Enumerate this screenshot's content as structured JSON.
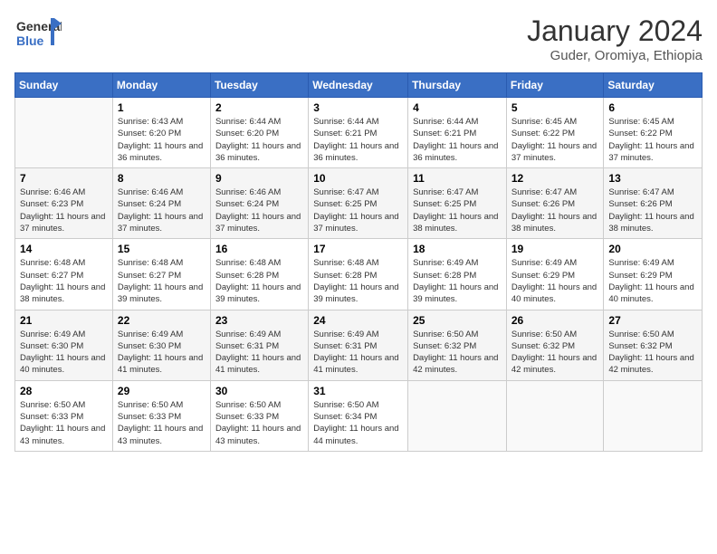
{
  "logo": {
    "general": "General",
    "blue": "Blue"
  },
  "title": "January 2024",
  "subtitle": "Guder, Oromiya, Ethiopia",
  "days_of_week": [
    "Sunday",
    "Monday",
    "Tuesday",
    "Wednesday",
    "Thursday",
    "Friday",
    "Saturday"
  ],
  "weeks": [
    [
      {
        "day": "",
        "sunrise": "",
        "sunset": "",
        "daylight": ""
      },
      {
        "day": "1",
        "sunrise": "Sunrise: 6:43 AM",
        "sunset": "Sunset: 6:20 PM",
        "daylight": "Daylight: 11 hours and 36 minutes."
      },
      {
        "day": "2",
        "sunrise": "Sunrise: 6:44 AM",
        "sunset": "Sunset: 6:20 PM",
        "daylight": "Daylight: 11 hours and 36 minutes."
      },
      {
        "day": "3",
        "sunrise": "Sunrise: 6:44 AM",
        "sunset": "Sunset: 6:21 PM",
        "daylight": "Daylight: 11 hours and 36 minutes."
      },
      {
        "day": "4",
        "sunrise": "Sunrise: 6:44 AM",
        "sunset": "Sunset: 6:21 PM",
        "daylight": "Daylight: 11 hours and 36 minutes."
      },
      {
        "day": "5",
        "sunrise": "Sunrise: 6:45 AM",
        "sunset": "Sunset: 6:22 PM",
        "daylight": "Daylight: 11 hours and 37 minutes."
      },
      {
        "day": "6",
        "sunrise": "Sunrise: 6:45 AM",
        "sunset": "Sunset: 6:22 PM",
        "daylight": "Daylight: 11 hours and 37 minutes."
      }
    ],
    [
      {
        "day": "7",
        "sunrise": "Sunrise: 6:46 AM",
        "sunset": "Sunset: 6:23 PM",
        "daylight": "Daylight: 11 hours and 37 minutes."
      },
      {
        "day": "8",
        "sunrise": "Sunrise: 6:46 AM",
        "sunset": "Sunset: 6:24 PM",
        "daylight": "Daylight: 11 hours and 37 minutes."
      },
      {
        "day": "9",
        "sunrise": "Sunrise: 6:46 AM",
        "sunset": "Sunset: 6:24 PM",
        "daylight": "Daylight: 11 hours and 37 minutes."
      },
      {
        "day": "10",
        "sunrise": "Sunrise: 6:47 AM",
        "sunset": "Sunset: 6:25 PM",
        "daylight": "Daylight: 11 hours and 37 minutes."
      },
      {
        "day": "11",
        "sunrise": "Sunrise: 6:47 AM",
        "sunset": "Sunset: 6:25 PM",
        "daylight": "Daylight: 11 hours and 38 minutes."
      },
      {
        "day": "12",
        "sunrise": "Sunrise: 6:47 AM",
        "sunset": "Sunset: 6:26 PM",
        "daylight": "Daylight: 11 hours and 38 minutes."
      },
      {
        "day": "13",
        "sunrise": "Sunrise: 6:47 AM",
        "sunset": "Sunset: 6:26 PM",
        "daylight": "Daylight: 11 hours and 38 minutes."
      }
    ],
    [
      {
        "day": "14",
        "sunrise": "Sunrise: 6:48 AM",
        "sunset": "Sunset: 6:27 PM",
        "daylight": "Daylight: 11 hours and 38 minutes."
      },
      {
        "day": "15",
        "sunrise": "Sunrise: 6:48 AM",
        "sunset": "Sunset: 6:27 PM",
        "daylight": "Daylight: 11 hours and 39 minutes."
      },
      {
        "day": "16",
        "sunrise": "Sunrise: 6:48 AM",
        "sunset": "Sunset: 6:28 PM",
        "daylight": "Daylight: 11 hours and 39 minutes."
      },
      {
        "day": "17",
        "sunrise": "Sunrise: 6:48 AM",
        "sunset": "Sunset: 6:28 PM",
        "daylight": "Daylight: 11 hours and 39 minutes."
      },
      {
        "day": "18",
        "sunrise": "Sunrise: 6:49 AM",
        "sunset": "Sunset: 6:28 PM",
        "daylight": "Daylight: 11 hours and 39 minutes."
      },
      {
        "day": "19",
        "sunrise": "Sunrise: 6:49 AM",
        "sunset": "Sunset: 6:29 PM",
        "daylight": "Daylight: 11 hours and 40 minutes."
      },
      {
        "day": "20",
        "sunrise": "Sunrise: 6:49 AM",
        "sunset": "Sunset: 6:29 PM",
        "daylight": "Daylight: 11 hours and 40 minutes."
      }
    ],
    [
      {
        "day": "21",
        "sunrise": "Sunrise: 6:49 AM",
        "sunset": "Sunset: 6:30 PM",
        "daylight": "Daylight: 11 hours and 40 minutes."
      },
      {
        "day": "22",
        "sunrise": "Sunrise: 6:49 AM",
        "sunset": "Sunset: 6:30 PM",
        "daylight": "Daylight: 11 hours and 41 minutes."
      },
      {
        "day": "23",
        "sunrise": "Sunrise: 6:49 AM",
        "sunset": "Sunset: 6:31 PM",
        "daylight": "Daylight: 11 hours and 41 minutes."
      },
      {
        "day": "24",
        "sunrise": "Sunrise: 6:49 AM",
        "sunset": "Sunset: 6:31 PM",
        "daylight": "Daylight: 11 hours and 41 minutes."
      },
      {
        "day": "25",
        "sunrise": "Sunrise: 6:50 AM",
        "sunset": "Sunset: 6:32 PM",
        "daylight": "Daylight: 11 hours and 42 minutes."
      },
      {
        "day": "26",
        "sunrise": "Sunrise: 6:50 AM",
        "sunset": "Sunset: 6:32 PM",
        "daylight": "Daylight: 11 hours and 42 minutes."
      },
      {
        "day": "27",
        "sunrise": "Sunrise: 6:50 AM",
        "sunset": "Sunset: 6:32 PM",
        "daylight": "Daylight: 11 hours and 42 minutes."
      }
    ],
    [
      {
        "day": "28",
        "sunrise": "Sunrise: 6:50 AM",
        "sunset": "Sunset: 6:33 PM",
        "daylight": "Daylight: 11 hours and 43 minutes."
      },
      {
        "day": "29",
        "sunrise": "Sunrise: 6:50 AM",
        "sunset": "Sunset: 6:33 PM",
        "daylight": "Daylight: 11 hours and 43 minutes."
      },
      {
        "day": "30",
        "sunrise": "Sunrise: 6:50 AM",
        "sunset": "Sunset: 6:33 PM",
        "daylight": "Daylight: 11 hours and 43 minutes."
      },
      {
        "day": "31",
        "sunrise": "Sunrise: 6:50 AM",
        "sunset": "Sunset: 6:34 PM",
        "daylight": "Daylight: 11 hours and 44 minutes."
      },
      {
        "day": "",
        "sunrise": "",
        "sunset": "",
        "daylight": ""
      },
      {
        "day": "",
        "sunrise": "",
        "sunset": "",
        "daylight": ""
      },
      {
        "day": "",
        "sunrise": "",
        "sunset": "",
        "daylight": ""
      }
    ]
  ]
}
